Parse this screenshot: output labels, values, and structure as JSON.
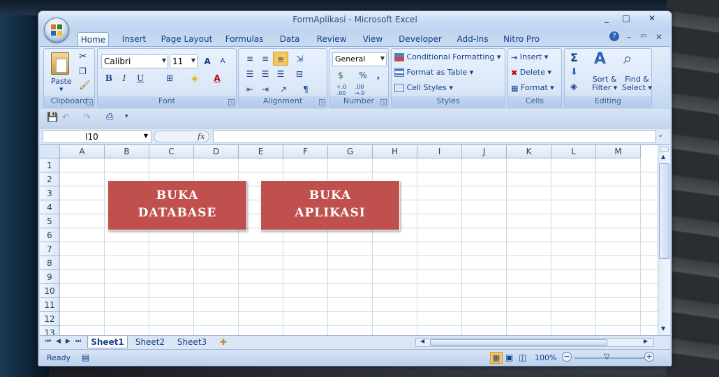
{
  "window": {
    "title": "FormAplikasi - Microsoft Excel",
    "controls": [
      "_",
      "□",
      "✕"
    ]
  },
  "tabs": [
    "Home",
    "Insert",
    "Page Layout",
    "Formulas",
    "Data",
    "Review",
    "View",
    "Developer",
    "Add-Ins",
    "Nitro Pro"
  ],
  "active_tab": "Home",
  "ribbon": {
    "clipboard": {
      "label": "Clipboard",
      "paste": "Paste"
    },
    "font": {
      "label": "Font",
      "name": "Calibri",
      "size": "11",
      "grow": "A",
      "shrink": "A",
      "bold": "B",
      "italic": "I",
      "underline": "U"
    },
    "alignment": {
      "label": "Alignment"
    },
    "number": {
      "label": "Number",
      "format": "General",
      "percent": "%",
      "comma": ",",
      "inc": "+.0 .00",
      "dec": ".00 →.0"
    },
    "styles": {
      "label": "Styles",
      "conditional": "Conditional Formatting",
      "table": "Format as Table",
      "cell": "Cell Styles"
    },
    "cells": {
      "label": "Cells",
      "insert": "Insert",
      "delete": "Delete",
      "format": "Format"
    },
    "editing": {
      "label": "Editing",
      "sigma": "Σ",
      "sort": "Sort &",
      "sort2": "Filter",
      "find": "Find &",
      "find2": "Select"
    }
  },
  "formula_bar": {
    "name_box": "I10",
    "fx": "fx"
  },
  "columns": [
    "A",
    "B",
    "C",
    "D",
    "E",
    "F",
    "G",
    "H",
    "I",
    "J",
    "K",
    "L",
    "M"
  ],
  "rows": [
    "1",
    "2",
    "3",
    "4",
    "5",
    "6",
    "7",
    "8",
    "9",
    "10",
    "11",
    "12",
    "13"
  ],
  "buttons": {
    "database_line1": "BUKA",
    "database_line2": "DATABASE",
    "app_line1": "BUKA",
    "app_line2": "APLIKASI"
  },
  "sheets": [
    "Sheet1",
    "Sheet2",
    "Sheet3"
  ],
  "active_sheet": "Sheet1",
  "status": {
    "ready": "Ready",
    "zoom": "100%"
  },
  "colors": {
    "button": "#c0504d",
    "ribbon": "#dbe7f7"
  }
}
